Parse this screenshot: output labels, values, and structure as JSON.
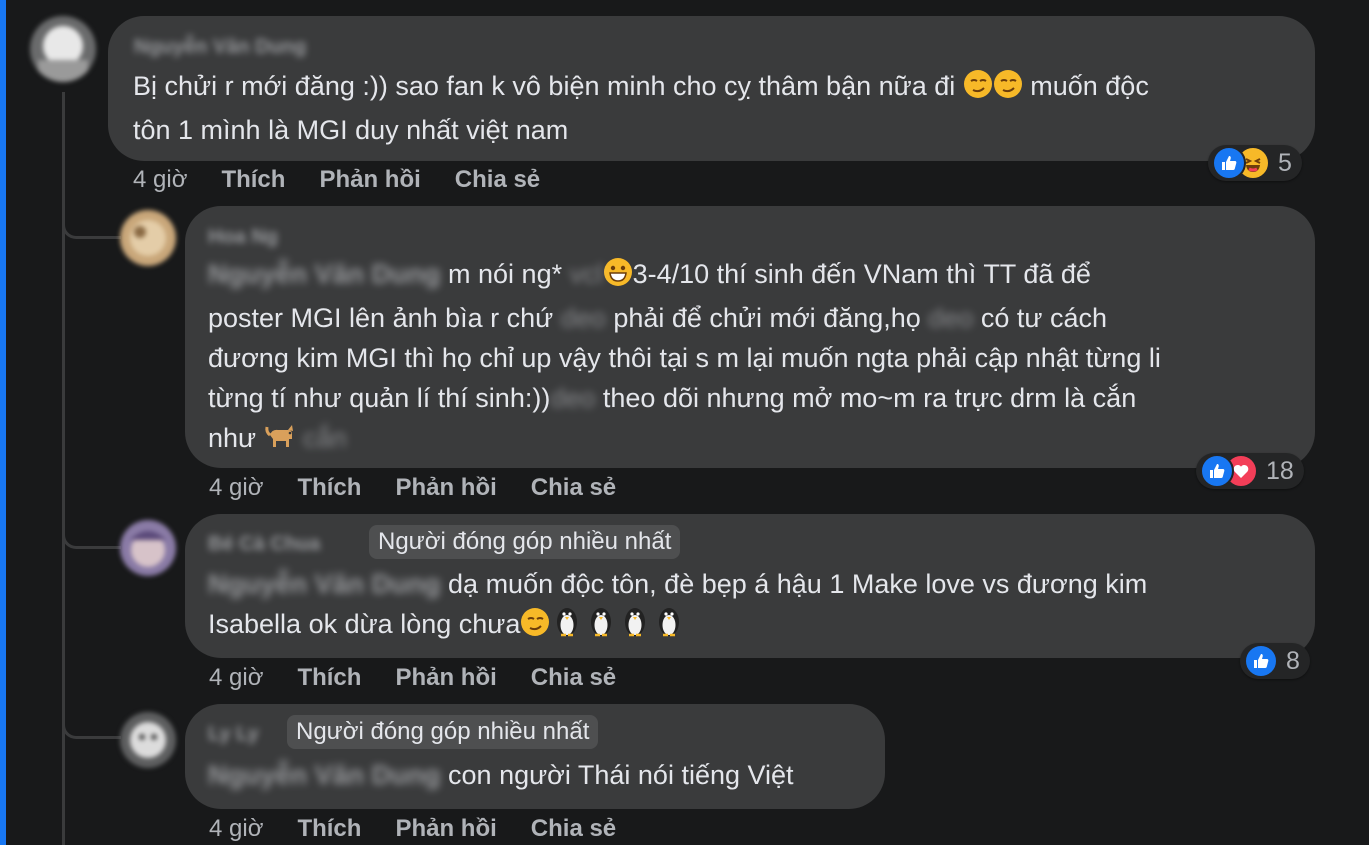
{
  "comments": [
    {
      "name": "Nguyễn Văn Dung",
      "text_parts": [
        "Bị chửi r mới đăng :)) sao fan k vô biện minh cho cỵ thâm bận nữa đi ",
        " muốn độc",
        "tôn 1 mình là MGI duy nhất việt nam"
      ],
      "reaction_count": "5",
      "time": "4 giờ"
    },
    {
      "name": "Hoa Ng",
      "mention": "Nguyễn Văn Dung",
      "text_parts": [
        "m nói ng* ",
        "vcl",
        "3-4/10 thí sinh đến VNam thì TT đã để",
        "poster MGI lên ảnh bìa r chứ ",
        "deo",
        " phải để chửi mới đăng,họ ",
        "deo",
        " có tư cách",
        "đương kim MGI thì họ chỉ up vậy thôi tại s m lại muốn ngta phải cập nhật từng li",
        "từng tí như quản lí thí sinh:))",
        "deo",
        " theo dõi nhưng mở mo~m ra trực drm là cắn",
        "như ",
        "cắn"
      ],
      "reaction_count": "18",
      "time": "4 giờ"
    },
    {
      "name": "Bé Cà Chua",
      "badge": "Người đóng góp nhiều nhất",
      "mention": "Nguyễn Văn Dung",
      "text_parts": [
        "dạ muốn độc tôn, đè bẹp á hậu 1 Make love vs đương kim",
        "Isabella ok dừa lòng chưa"
      ],
      "reaction_count": "8",
      "time": "4 giờ"
    },
    {
      "name": "Ly Ly",
      "badge": "Người đóng góp nhiều nhất",
      "mention": "Nguyễn Văn Dung",
      "text_parts": [
        "con người Thái nói tiếng Việt"
      ],
      "time": "4 giờ"
    }
  ],
  "actions": {
    "like": "Thích",
    "reply": "Phản hồi",
    "share": "Chia sẻ"
  },
  "colors": {
    "background": "#18191a",
    "bubble": "#3a3b3c",
    "like_blue": "#1877f2",
    "heart_red": "#f33e58",
    "haha_yellow": "#f7b928"
  },
  "icons": [
    "smirk-emoji-icon",
    "grin-emoji-icon",
    "dog-emoji-icon",
    "penguin-emoji-icon",
    "like-reaction-icon",
    "haha-reaction-icon",
    "love-reaction-icon"
  ]
}
